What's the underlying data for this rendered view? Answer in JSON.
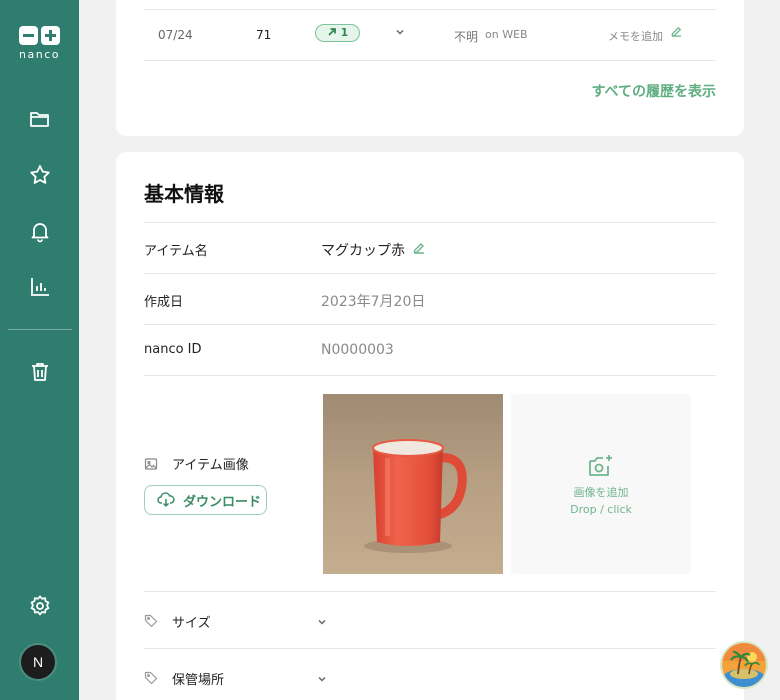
{
  "brand": {
    "logo_text": "nanco"
  },
  "sidebar": {
    "items": [
      {
        "icon": "folder-icon"
      },
      {
        "icon": "star-icon"
      },
      {
        "icon": "bell-icon"
      },
      {
        "icon": "chart-icon"
      },
      {
        "icon": "trash-icon"
      }
    ],
    "settings_icon": "gear-icon",
    "avatar_initial": "N"
  },
  "history": {
    "row": {
      "date": "07/24",
      "quantity": "71",
      "change": "1",
      "by": "不明",
      "via": "on WEB",
      "memo": "メモを追加"
    },
    "show_all": "すべての履歴を表示"
  },
  "basic_info": {
    "title": "基本情報",
    "item_name_label": "アイテム名",
    "item_name": "マグカップ赤",
    "created_label": "作成日",
    "created": "2023年7月20日",
    "id_label": "nanco ID",
    "id": "N0000003",
    "image_label": "アイテム画像",
    "download_label": "ダウンロード",
    "add_image": "画像を追加",
    "add_image_hint": "Drop / click",
    "size_label": "サイズ",
    "location_label": "保管場所"
  },
  "colors": {
    "sidebar": "#2e7d6e",
    "accent": "#5fae80",
    "badge_bg": "#e6f5ec"
  }
}
